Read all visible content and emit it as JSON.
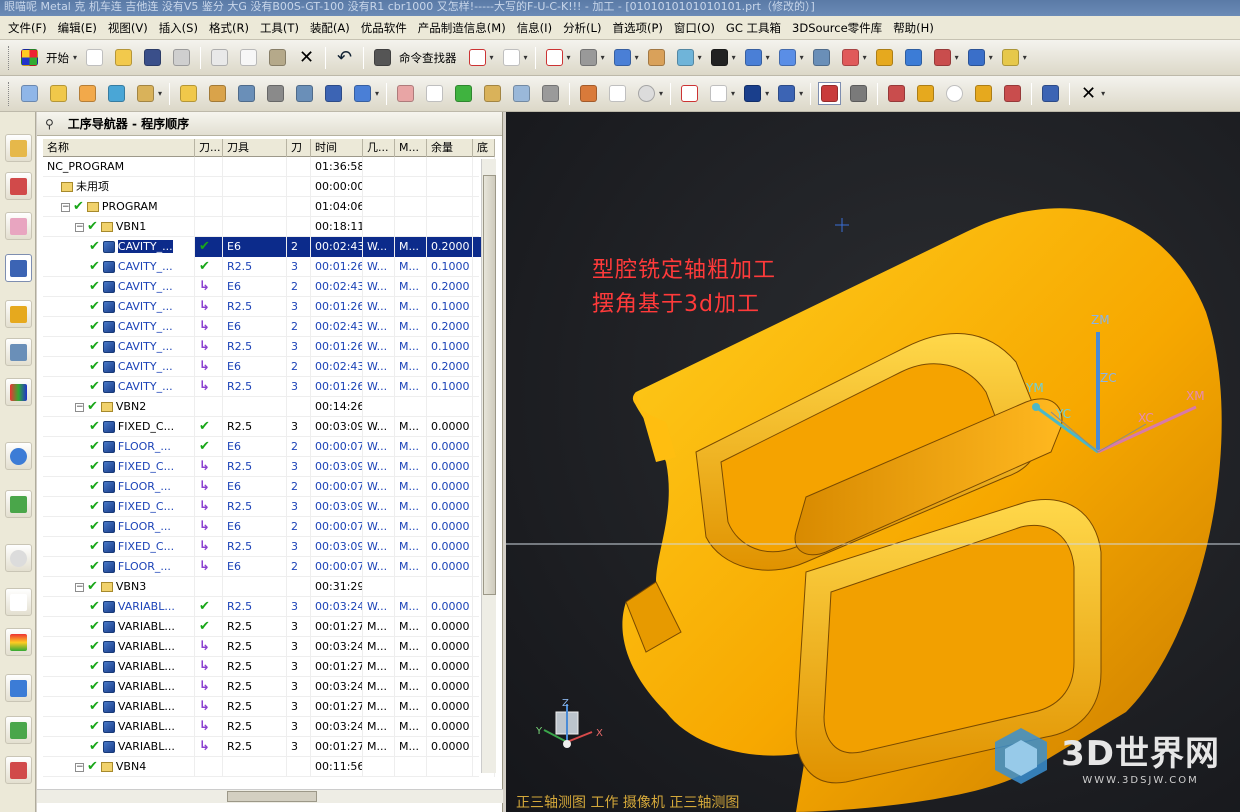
{
  "window": {
    "title": "眼喵呢  Metal 克 机车连 吉他连 没有V5 鉴分 大G 没有B00S-GT-100 没有R1 cbr1000 又怎样!-----大写的F-U-C-K!!! - 加工 - [0101010101010101.prt（修改的）]"
  },
  "menu": [
    "文件(F)",
    "编辑(E)",
    "视图(V)",
    "插入(S)",
    "格式(R)",
    "工具(T)",
    "装配(A)",
    "优品软件",
    "产品制造信息(M)",
    "信息(I)",
    "分析(L)",
    "首选项(P)",
    "窗口(O)",
    "GC 工具箱",
    "3DSource零件库",
    "帮助(H)"
  ],
  "toolbar": {
    "start_label": "开始",
    "command_finder_label": "命令查找器"
  },
  "navigator": {
    "title": "工序导航器 - 程序顺序"
  },
  "columns": [
    "名称",
    "刀...",
    "刀具",
    "刀",
    "时间",
    "几...",
    "M...",
    "余量",
    "底"
  ],
  "rows": [
    {
      "name": "NC_PROGRAM",
      "time": "01:36:58"
    },
    {
      "name": "未用项",
      "time": "00:00:00"
    },
    {
      "name": "PROGRAM",
      "time": "01:04:06"
    },
    {
      "name": "VBN1",
      "time": "00:18:11"
    },
    {
      "name": "CAVITY_...",
      "tool": "E6",
      "tn": "2",
      "time": "00:02:43",
      "geo": "W...",
      "meth": "M...",
      "stock": "0.2000"
    },
    {
      "name": "CAVITY_...",
      "tool": "R2.5",
      "tn": "3",
      "time": "00:01:26",
      "geo": "W...",
      "meth": "M...",
      "stock": "0.1000"
    },
    {
      "name": "CAVITY_...",
      "tool": "E6",
      "tn": "2",
      "time": "00:02:43",
      "geo": "W...",
      "meth": "M...",
      "stock": "0.2000"
    },
    {
      "name": "CAVITY_...",
      "tool": "R2.5",
      "tn": "3",
      "time": "00:01:26",
      "geo": "W...",
      "meth": "M...",
      "stock": "0.1000"
    },
    {
      "name": "CAVITY_...",
      "tool": "E6",
      "tn": "2",
      "time": "00:02:43",
      "geo": "W...",
      "meth": "M...",
      "stock": "0.2000"
    },
    {
      "name": "CAVITY_...",
      "tool": "R2.5",
      "tn": "3",
      "time": "00:01:26",
      "geo": "W...",
      "meth": "M...",
      "stock": "0.1000"
    },
    {
      "name": "CAVITY_...",
      "tool": "E6",
      "tn": "2",
      "time": "00:02:43",
      "geo": "W...",
      "meth": "M...",
      "stock": "0.2000"
    },
    {
      "name": "CAVITY_...",
      "tool": "R2.5",
      "tn": "3",
      "time": "00:01:26",
      "geo": "W...",
      "meth": "M...",
      "stock": "0.1000"
    },
    {
      "name": "VBN2",
      "time": "00:14:26"
    },
    {
      "name": "FIXED_C...",
      "tool": "R2.5",
      "tn": "3",
      "time": "00:03:09",
      "geo": "W...",
      "meth": "M...",
      "stock": "0.0000"
    },
    {
      "name": "FLOOR_...",
      "tool": "E6",
      "tn": "2",
      "time": "00:00:07",
      "geo": "W...",
      "meth": "M...",
      "stock": "0.0000"
    },
    {
      "name": "FIXED_C...",
      "tool": "R2.5",
      "tn": "3",
      "time": "00:03:09",
      "geo": "W...",
      "meth": "M...",
      "stock": "0.0000"
    },
    {
      "name": "FLOOR_...",
      "tool": "E6",
      "tn": "2",
      "time": "00:00:07",
      "geo": "W...",
      "meth": "M...",
      "stock": "0.0000"
    },
    {
      "name": "FIXED_C...",
      "tool": "R2.5",
      "tn": "3",
      "time": "00:03:09",
      "geo": "W...",
      "meth": "M...",
      "stock": "0.0000"
    },
    {
      "name": "FLOOR_...",
      "tool": "E6",
      "tn": "2",
      "time": "00:00:07",
      "geo": "W...",
      "meth": "M...",
      "stock": "0.0000"
    },
    {
      "name": "FIXED_C...",
      "tool": "R2.5",
      "tn": "3",
      "time": "00:03:09",
      "geo": "W...",
      "meth": "M...",
      "stock": "0.0000"
    },
    {
      "name": "FLOOR_...",
      "tool": "E6",
      "tn": "2",
      "time": "00:00:07",
      "geo": "W...",
      "meth": "M...",
      "stock": "0.0000"
    },
    {
      "name": "VBN3",
      "time": "00:31:29"
    },
    {
      "name": "VARIABL...",
      "tool": "R2.5",
      "tn": "3",
      "time": "00:03:24",
      "geo": "W...",
      "meth": "M...",
      "stock": "0.0000"
    },
    {
      "name": "VARIABL...",
      "tool": "R2.5",
      "tn": "3",
      "time": "00:01:27",
      "geo": "M...",
      "meth": "M...",
      "stock": "0.0000"
    },
    {
      "name": "VARIABL...",
      "tool": "R2.5",
      "tn": "3",
      "time": "00:03:24",
      "geo": "M...",
      "meth": "M...",
      "stock": "0.0000"
    },
    {
      "name": "VARIABL...",
      "tool": "R2.5",
      "tn": "3",
      "time": "00:01:27",
      "geo": "M...",
      "meth": "M...",
      "stock": "0.0000"
    },
    {
      "name": "VARIABL...",
      "tool": "R2.5",
      "tn": "3",
      "time": "00:03:24",
      "geo": "M...",
      "meth": "M...",
      "stock": "0.0000"
    },
    {
      "name": "VARIABL...",
      "tool": "R2.5",
      "tn": "3",
      "time": "00:01:27",
      "geo": "M...",
      "meth": "M...",
      "stock": "0.0000"
    },
    {
      "name": "VARIABL...",
      "tool": "R2.5",
      "tn": "3",
      "time": "00:03:24",
      "geo": "M...",
      "meth": "M...",
      "stock": "0.0000"
    },
    {
      "name": "VARIABL...",
      "tool": "R2.5",
      "tn": "3",
      "time": "00:01:27",
      "geo": "M...",
      "meth": "M...",
      "stock": "0.0000"
    },
    {
      "name": "VBN4",
      "time": "00:11:56"
    }
  ],
  "viewport": {
    "annotation_line1": "型腔铣定轴粗加工",
    "annotation_line2": "摆角基于3d加工",
    "status": "正三轴测图  工作  摄像机  正三轴测图",
    "axes": {
      "zm": "ZM",
      "zc": "ZC",
      "yc": "YC",
      "ym": "YM",
      "xc": "XC",
      "xm": "XM",
      "tx": "X",
      "ty": "Y",
      "tz": "Z"
    },
    "watermark": {
      "brand": "3D世界网",
      "url": "WWW.3DSJW.COM"
    },
    "part_color": "#f7a800"
  }
}
